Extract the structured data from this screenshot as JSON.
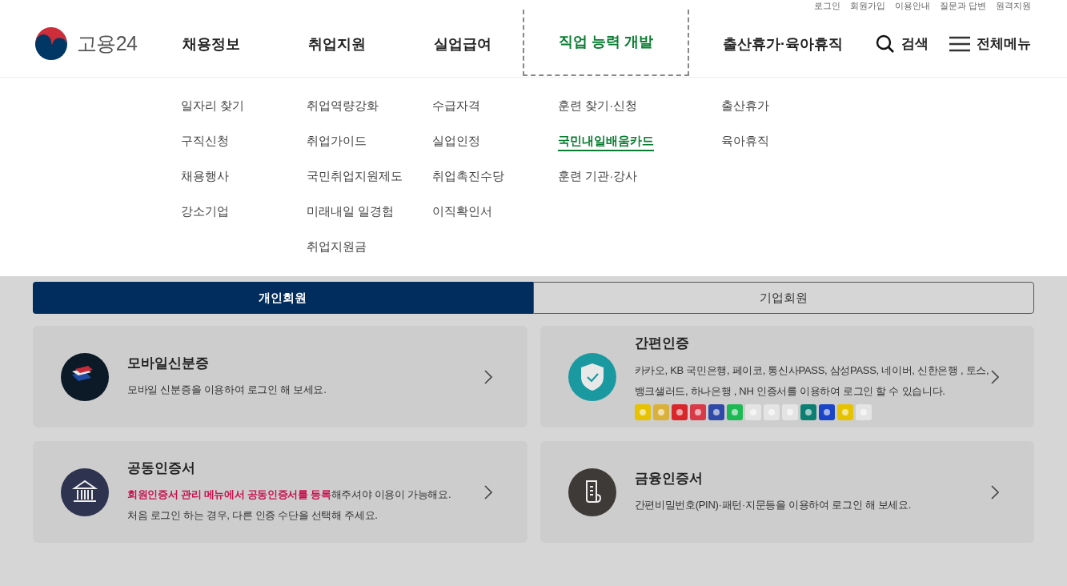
{
  "utility_links": [
    "로그인",
    "회원가입",
    "이용안내",
    "질문과 답변",
    "원격지원"
  ],
  "logo": {
    "text": "고용24"
  },
  "nav": [
    {
      "label": "채용정보",
      "selected": false
    },
    {
      "label": "취업지원",
      "selected": false
    },
    {
      "label": "실업급여",
      "selected": false
    },
    {
      "label": "직업 능력 개발",
      "selected": true
    },
    {
      "label": "출산휴가·육아휴직",
      "selected": false
    }
  ],
  "search": {
    "label": "검색"
  },
  "all_menu": {
    "label": "전체메뉴"
  },
  "submenu_columns": [
    [
      {
        "label": "일자리 찾기",
        "selected": false
      },
      {
        "label": "구직신청",
        "selected": false
      },
      {
        "label": "채용행사",
        "selected": false
      },
      {
        "label": "강소기업",
        "selected": false
      }
    ],
    [
      {
        "label": "취업역량강화",
        "selected": false
      },
      {
        "label": "취업가이드",
        "selected": false
      },
      {
        "label": "국민취업지원제도",
        "selected": false
      },
      {
        "label": "미래내일 일경험",
        "selected": false
      },
      {
        "label": "취업지원금",
        "selected": false
      }
    ],
    [
      {
        "label": "수급자격",
        "selected": false
      },
      {
        "label": "실업인정",
        "selected": false
      },
      {
        "label": "취업촉진수당",
        "selected": false
      },
      {
        "label": "이직확인서",
        "selected": false
      }
    ],
    [
      {
        "label": "훈련 찾기·신청",
        "selected": false
      },
      {
        "label": "국민내일배움카드",
        "selected": true
      },
      {
        "label": "훈련 기관·강사",
        "selected": false
      }
    ],
    [
      {
        "label": "출산휴가",
        "selected": false
      },
      {
        "label": "육아휴직",
        "selected": false
      }
    ]
  ],
  "member_tabs": [
    {
      "label": "개인회원",
      "selected": true
    },
    {
      "label": "기업회원",
      "selected": false
    }
  ],
  "login_methods": [
    {
      "kind": "mobile-id",
      "title": "모바일신분증",
      "lines": [
        "모바일 신분증을 이용하여 로그인 해 보세요."
      ]
    },
    {
      "kind": "easy-auth",
      "title": "간편인증",
      "lines": [
        "카카오, KB 국민은행, 페이코, 통신사PASS, 삼성PASS, 네이버, 신한은행 , 토스,",
        "뱅크샐러드, 하나은행 , NH 인증서를 이용하여 로그인 할 수 있습니다."
      ],
      "provider_logos": [
        {
          "color": "#e6c200"
        },
        {
          "color": "#d9b13a"
        },
        {
          "color": "#d8262b"
        },
        {
          "color": "#d83a48"
        },
        {
          "color": "#2f49a8"
        },
        {
          "color": "#1db954"
        },
        {
          "color": "#e4e4e4"
        },
        {
          "color": "#e4e4e4"
        },
        {
          "color": "#e4e4e4"
        },
        {
          "color": "#0d7f72"
        },
        {
          "color": "#1b44c8"
        },
        {
          "color": "#e6c200"
        },
        {
          "color": "#e4e4e4"
        }
      ]
    },
    {
      "kind": "joint-cert",
      "title": "공동인증서",
      "lines": [
        "**회원인증서 관리 메뉴에서 공동인증서를 등록**해주셔야 이용이 가능해요.",
        "처음 로그인 하는 경우, 다른 인증 수단을 선택해 주세요."
      ]
    },
    {
      "kind": "financial-cert",
      "title": "금융인증서",
      "lines": [
        "간편비밀번호(PIN)·패턴·지문등을 이용하여 로그인 해 보세요."
      ]
    }
  ]
}
